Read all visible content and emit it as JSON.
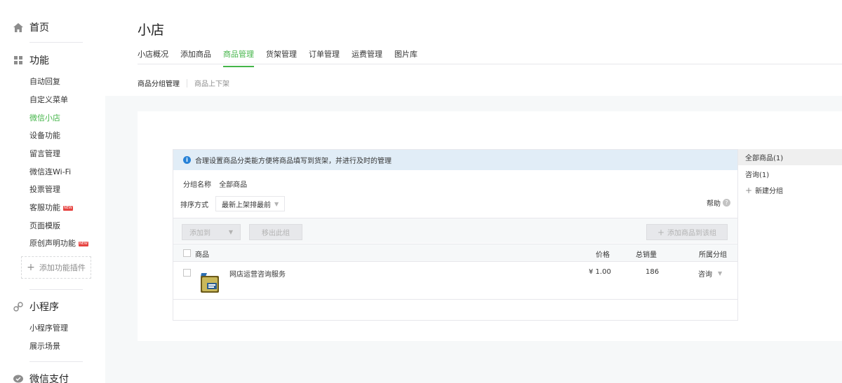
{
  "sidebar": {
    "home": "首页",
    "features": "功能",
    "items": [
      {
        "label": "自动回复",
        "active": false,
        "badge": ""
      },
      {
        "label": "自定义菜单",
        "active": false,
        "badge": ""
      },
      {
        "label": "微信小店",
        "active": true,
        "badge": ""
      },
      {
        "label": "设备功能",
        "active": false,
        "badge": ""
      },
      {
        "label": "留言管理",
        "active": false,
        "badge": ""
      },
      {
        "label": "微信连Wi-Fi",
        "active": false,
        "badge": ""
      },
      {
        "label": "投票管理",
        "active": false,
        "badge": ""
      },
      {
        "label": "客服功能",
        "active": false,
        "badge": "NEW"
      },
      {
        "label": "页面模版",
        "active": false,
        "badge": ""
      },
      {
        "label": "原创声明功能",
        "active": false,
        "badge": "NEW"
      }
    ],
    "add_plugin": "添加功能插件",
    "miniprogram": "小程序",
    "mini_items": [
      "小程序管理",
      "展示场景"
    ],
    "pay": "微信支付"
  },
  "page": {
    "title": "小店",
    "tabs": [
      "小店概况",
      "添加商品",
      "商品管理",
      "货架管理",
      "订单管理",
      "运费管理",
      "图片库"
    ],
    "active_tab": 2,
    "subtabs": [
      "商品分组管理",
      "商品上下架"
    ]
  },
  "panel": {
    "tip": "合理设置商品分类能方便将商品填写到货架，并进行及时的管理",
    "group_label": "分组名称",
    "group_value": "全部商品",
    "sort_label": "排序方式",
    "sort_value": "最新上架排最前",
    "help": "帮助",
    "btn_add_to": "添加到",
    "btn_remove": "移出此组",
    "btn_add_product": "添加商品到该组",
    "columns": {
      "product": "商品",
      "price": "价格",
      "sales": "总销量",
      "group": "所属分组"
    },
    "rows": [
      {
        "name": "网店运营咨询服务",
        "price": "¥ 1.00",
        "sales": "186",
        "group": "咨询"
      }
    ]
  },
  "groups": {
    "items": [
      "全部商品(1)",
      "咨询(1)"
    ],
    "new_group": "新建分组"
  },
  "colors": {
    "accent": "#44b549",
    "tip_bg": "#e1edf7",
    "info_blue": "#2782d7",
    "badge_red": "#e64340"
  }
}
